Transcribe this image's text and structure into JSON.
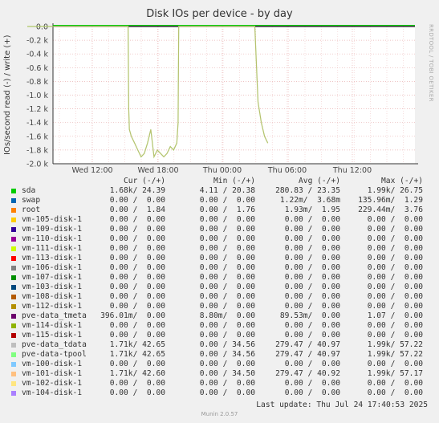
{
  "title": "Disk IOs per device - by day",
  "side_text": "RRDTOOL / TOBI OETIKER",
  "ylabel": "IOs/second read (-) / write (+)",
  "chart_data": {
    "type": "line",
    "title": "Disk IOs per device - by day",
    "ylabel": "IOs/second read (-) / write (+)",
    "ylim": [
      -2.0,
      0.0
    ],
    "yticks": [
      "0.0",
      "-0.2 k",
      "-0.4 k",
      "-0.6 k",
      "-0.8 k",
      "-1.0 k",
      "-1.2 k",
      "-1.4 k",
      "-1.6 k",
      "-1.8 k",
      "-2.0 k"
    ],
    "xticks": [
      "Wed 12:00",
      "Wed 18:00",
      "Thu 00:00",
      "Thu 06:00",
      "Thu 12:00"
    ],
    "grid": true,
    "series": [
      {
        "name": "sda",
        "color": "#00cc00",
        "values_k": [
          [
            -1.0,
            0.0
          ],
          [
            0.0,
            0.0
          ],
          [
            0.55,
            0.0
          ],
          [
            0.56,
            -1.2
          ],
          [
            0.57,
            -1.5
          ],
          [
            0.6,
            -1.6
          ],
          [
            0.65,
            -1.7
          ],
          [
            0.7,
            -1.8
          ],
          [
            0.75,
            -1.9
          ],
          [
            0.8,
            -1.85
          ],
          [
            0.85,
            -1.7
          ],
          [
            0.9,
            -1.5
          ],
          [
            0.95,
            -1.9
          ],
          [
            1.0,
            -1.8
          ],
          [
            1.05,
            -1.85
          ],
          [
            1.1,
            -1.9
          ],
          [
            1.15,
            -1.85
          ],
          [
            1.2,
            -1.75
          ],
          [
            1.25,
            -1.8
          ],
          [
            1.3,
            -1.7
          ],
          [
            1.32,
            -1.4
          ],
          [
            1.33,
            -0.0
          ],
          [
            2.5,
            0.0
          ],
          [
            2.55,
            -1.1
          ],
          [
            2.6,
            -1.4
          ],
          [
            2.65,
            -1.6
          ],
          [
            2.7,
            -1.7
          ]
        ]
      },
      {
        "name": "pve-data_tdata",
        "color": "#c8c8c8"
      },
      {
        "name": "pve-data-tpool",
        "color": "#99cc66"
      },
      {
        "name": "vm-101-disk-1",
        "color": "#ffcc99"
      }
    ]
  },
  "legend": {
    "headers": {
      "cur": "Cur (-/+)",
      "min": "Min (-/+)",
      "avg": "Avg (-/+)",
      "max": "Max (-/+)"
    },
    "rows": [
      {
        "name": "sda",
        "color": "#00cc00",
        "cur": "1.68k/ 24.39",
        "min": "4.11 / 20.38",
        "avg": "280.83 / 23.35",
        "max": "1.99k/ 26.75"
      },
      {
        "name": "swap",
        "color": "#0066b3",
        "cur": "0.00 /  0.00",
        "min": "0.00 /  0.00",
        "avg": "1.22m/  3.68m",
        "max": "135.96m/  1.29"
      },
      {
        "name": "root",
        "color": "#ff8000",
        "cur": "0.00 /  1.84",
        "min": "0.00 /  1.76",
        "avg": "1.93m/  1.95",
        "max": "229.44m/  3.76"
      },
      {
        "name": "vm-105-disk-1",
        "color": "#ffcc00",
        "cur": "0.00 /  0.00",
        "min": "0.00 /  0.00",
        "avg": "0.00 /  0.00",
        "max": "0.00 /  0.00"
      },
      {
        "name": "vm-109-disk-1",
        "color": "#330099",
        "cur": "0.00 /  0.00",
        "min": "0.00 /  0.00",
        "avg": "0.00 /  0.00",
        "max": "0.00 /  0.00"
      },
      {
        "name": "vm-110-disk-1",
        "color": "#990099",
        "cur": "0.00 /  0.00",
        "min": "0.00 /  0.00",
        "avg": "0.00 /  0.00",
        "max": "0.00 /  0.00"
      },
      {
        "name": "vm-111-disk-1",
        "color": "#ccff00",
        "cur": "0.00 /  0.00",
        "min": "0.00 /  0.00",
        "avg": "0.00 /  0.00",
        "max": "0.00 /  0.00"
      },
      {
        "name": "vm-113-disk-1",
        "color": "#ff0000",
        "cur": "0.00 /  0.00",
        "min": "0.00 /  0.00",
        "avg": "0.00 /  0.00",
        "max": "0.00 /  0.00"
      },
      {
        "name": "vm-106-disk-1",
        "color": "#808080",
        "cur": "0.00 /  0.00",
        "min": "0.00 /  0.00",
        "avg": "0.00 /  0.00",
        "max": "0.00 /  0.00"
      },
      {
        "name": "vm-107-disk-1",
        "color": "#008f00",
        "cur": "0.00 /  0.00",
        "min": "0.00 /  0.00",
        "avg": "0.00 /  0.00",
        "max": "0.00 /  0.00"
      },
      {
        "name": "vm-103-disk-1",
        "color": "#00487d",
        "cur": "0.00 /  0.00",
        "min": "0.00 /  0.00",
        "avg": "0.00 /  0.00",
        "max": "0.00 /  0.00"
      },
      {
        "name": "vm-108-disk-1",
        "color": "#b35a00",
        "cur": "0.00 /  0.00",
        "min": "0.00 /  0.00",
        "avg": "0.00 /  0.00",
        "max": "0.00 /  0.00"
      },
      {
        "name": "vm-112-disk-1",
        "color": "#b38f00",
        "cur": "0.00 /  0.00",
        "min": "0.00 /  0.00",
        "avg": "0.00 /  0.00",
        "max": "0.00 /  0.00"
      },
      {
        "name": "pve-data_tmeta",
        "color": "#6b006b",
        "cur": "396.01m/  0.00",
        "min": "8.80m/  0.00",
        "avg": "89.53m/  0.00",
        "max": "1.07 /  0.00"
      },
      {
        "name": "vm-114-disk-1",
        "color": "#8fb300",
        "cur": "0.00 /  0.00",
        "min": "0.00 /  0.00",
        "avg": "0.00 /  0.00",
        "max": "0.00 /  0.00"
      },
      {
        "name": "vm-115-disk-1",
        "color": "#b30000",
        "cur": "0.00 /  0.00",
        "min": "0.00 /  0.00",
        "avg": "0.00 /  0.00",
        "max": "0.00 /  0.00"
      },
      {
        "name": "pve-data_tdata",
        "color": "#bebebe",
        "cur": "1.71k/ 42.65",
        "min": "0.00 / 34.56",
        "avg": "279.47 / 40.97",
        "max": "1.99k/ 57.22"
      },
      {
        "name": "pve-data-tpool",
        "color": "#80ff80",
        "cur": "1.71k/ 42.65",
        "min": "0.00 / 34.56",
        "avg": "279.47 / 40.97",
        "max": "1.99k/ 57.22"
      },
      {
        "name": "vm-100-disk-1",
        "color": "#80c9ff",
        "cur": "0.00 /  0.00",
        "min": "0.00 /  0.00",
        "avg": "0.00 /  0.00",
        "max": "0.00 /  0.00"
      },
      {
        "name": "vm-101-disk-1",
        "color": "#ffc080",
        "cur": "1.71k/ 42.60",
        "min": "0.00 / 34.50",
        "avg": "279.47 / 40.92",
        "max": "1.99k/ 57.17"
      },
      {
        "name": "vm-102-disk-1",
        "color": "#ffe680",
        "cur": "0.00 /  0.00",
        "min": "0.00 /  0.00",
        "avg": "0.00 /  0.00",
        "max": "0.00 /  0.00"
      },
      {
        "name": "vm-104-disk-1",
        "color": "#aa80ff",
        "cur": "0.00 /  0.00",
        "min": "0.00 /  0.00",
        "avg": "0.00 /  0.00",
        "max": "0.00 /  0.00"
      }
    ]
  },
  "last_update": "Last update: Thu Jul 24 17:40:53 2025",
  "footer": "Munin 2.0.57"
}
